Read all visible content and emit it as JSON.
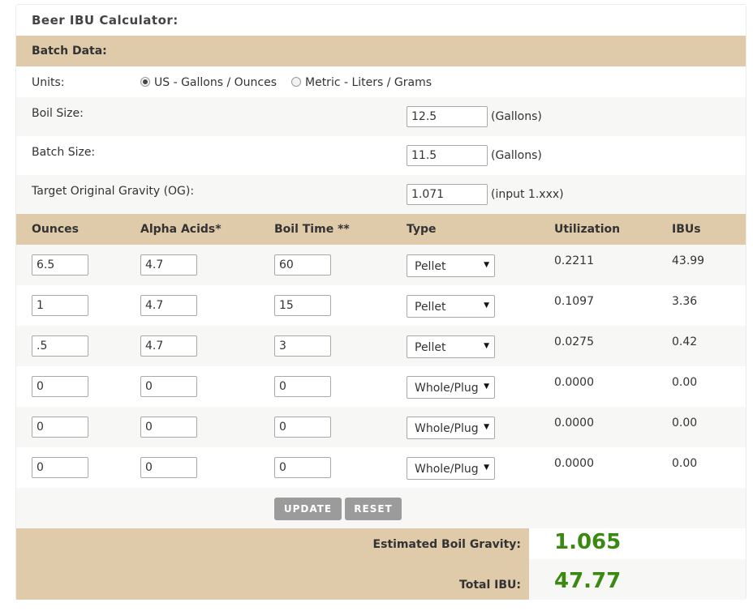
{
  "title": "Beer IBU Calculator:",
  "batch_header": "Batch Data:",
  "units": {
    "label": "Units:",
    "options": [
      "US - Gallons / Ounces",
      "Metric - Liters / Grams"
    ],
    "selected_index": 0
  },
  "boil_size": {
    "label": "Boil Size:",
    "value": "12.5",
    "unit": "(Gallons)"
  },
  "batch_size": {
    "label": "Batch Size:",
    "value": "11.5",
    "unit": "(Gallons)"
  },
  "og": {
    "label": "Target Original Gravity (OG):",
    "value": "1.071",
    "hint": "(input 1.xxx)"
  },
  "columns": [
    "Ounces",
    "Alpha Acids*",
    "Boil Time **",
    "Type",
    "Utilization",
    "IBUs"
  ],
  "hops": [
    {
      "ounces": "6.5",
      "alpha": "4.7",
      "time": "60",
      "type": "Pellet",
      "util": "0.2211",
      "ibu": "43.99"
    },
    {
      "ounces": "1",
      "alpha": "4.7",
      "time": "15",
      "type": "Pellet",
      "util": "0.1097",
      "ibu": "3.36"
    },
    {
      "ounces": ".5",
      "alpha": "4.7",
      "time": "3",
      "type": "Pellet",
      "util": "0.0275",
      "ibu": "0.42"
    },
    {
      "ounces": "0",
      "alpha": "0",
      "time": "0",
      "type": "Whole/Plug",
      "util": "0.0000",
      "ibu": "0.00"
    },
    {
      "ounces": "0",
      "alpha": "0",
      "time": "0",
      "type": "Whole/Plug",
      "util": "0.0000",
      "ibu": "0.00"
    },
    {
      "ounces": "0",
      "alpha": "0",
      "time": "0",
      "type": "Whole/Plug",
      "util": "0.0000",
      "ibu": "0.00"
    }
  ],
  "buttons": {
    "update": "UPDATE",
    "reset": "RESET"
  },
  "results": {
    "boil_gravity_label": "Estimated Boil Gravity:",
    "boil_gravity_value": "1.065",
    "total_ibu_label": "Total IBU:",
    "total_ibu_value": "47.77"
  },
  "colors": {
    "header_bg": "#dfcaa9",
    "result_green": "#3a8a12",
    "button_bg": "#9b9b9b"
  },
  "icons": {
    "select_arrow": "▼"
  }
}
